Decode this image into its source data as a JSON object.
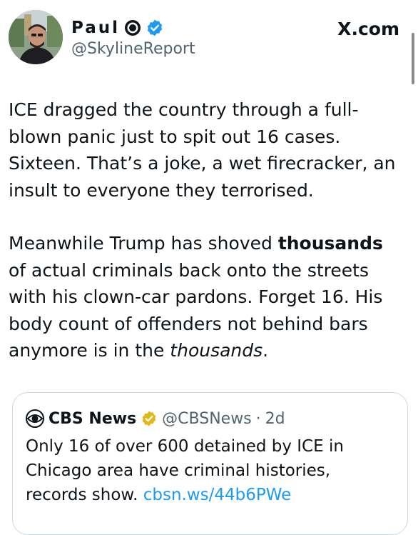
{
  "author": {
    "name": "Paul",
    "handle": "@SkylineReport"
  },
  "brand": "X.com",
  "tweet": {
    "lines_p1": [
      "ICE dragged the country through a full-",
      "blown panic just to spit out 16 cases.",
      "Sixteen. That’s a joke, a wet firecracker, an",
      "insult to everyone they terrorised."
    ],
    "p2_line1_pre": "Meanwhile Trump has shoved ",
    "p2_line1_bold": "thousands",
    "p2_lines_mid": [
      "of actual criminals back onto the streets",
      "with his clown-car pardons. Forget 16. His",
      "body count of offenders not behind bars"
    ],
    "p2_last_pre": "anymore is in the ",
    "p2_last_italic": "thousands",
    "p2_last_post": "."
  },
  "quote": {
    "name": "CBS News",
    "handle": "@CBSNews",
    "separator": "·",
    "time": "2d",
    "text_lines": [
      "Only 16 of over 600 detained by ICE in",
      "Chicago area have criminal histories,"
    ],
    "text_last_pre": "records show. ",
    "link": "cbsn.ws/44b6PWe"
  },
  "colors": {
    "verified_blue": "#1d9bf0",
    "verified_gold": "#e2b719",
    "link": "#1d9bf0",
    "secondary_text": "#536471"
  },
  "icons": [
    "avatar-photo",
    "affiliation-badge-icon",
    "verified-badge-icon",
    "cbs-eye-logo-icon",
    "gold-verified-badge-icon"
  ]
}
